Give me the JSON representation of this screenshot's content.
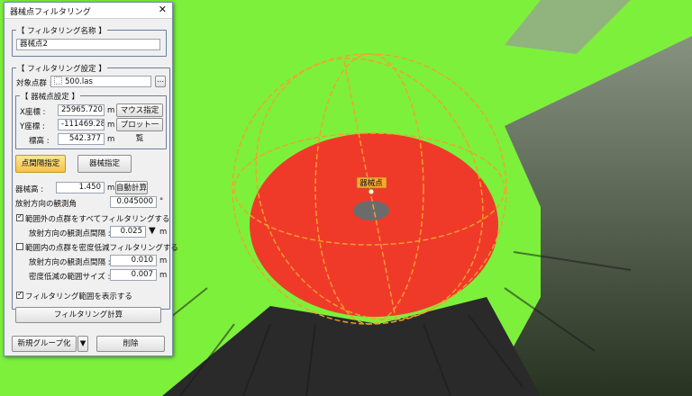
{
  "panel": {
    "title": "器械点フィルタリング",
    "close_glyph": "✕",
    "name_group": {
      "label": "【 フィルタリング名称 】",
      "value": "器械点2"
    },
    "settings_group": {
      "label": "【 フィルタリング設定 】",
      "target_label": "対象点群 :",
      "target_value": "500.las",
      "browse_glyph": "...",
      "instrument_group": {
        "label": "【 器械点設定 】",
        "x_label": "X座標 :",
        "x_value": "25965.720",
        "y_label": "Y座標 :",
        "y_value": "-111469.285",
        "h_label": "標高 :",
        "h_value": "542.377",
        "unit": "m",
        "mouse_button": "マウス指定",
        "plot_list_button": "プロット一覧"
      },
      "mode_point_spacing": "点間隔指定",
      "mode_grid": "器械指定",
      "instrument_height_label": "器械高 :",
      "instrument_height_value": "1.450",
      "auto_calc_button": "自動計算",
      "radial_angle_label": "放射方向の観測角",
      "radial_angle_value": "0.045000",
      "degree_symbol": "°",
      "outside_checkbox_label": "範囲外の点群をすべてフィルタリングする",
      "outside_checked": true,
      "radial_spacing_label": "放射方向の観測点間隔 :",
      "radial_spacing_value": "0.025",
      "inside_checkbox_label": "範囲内の点群を密度低減フィルタリングする",
      "inside_checked": false,
      "radial_spacing2_label": "放射方向の観測点間隔 :",
      "radial_spacing2_value": "0.010",
      "density_size_label": "密度低減の範囲サイズ :",
      "density_size_value": "0.007",
      "show_range_label": "フィルタリング範囲を表示する",
      "show_range_checked": true,
      "calc_button": "フィルタリング計算"
    },
    "new_group_button": "新規グループ化",
    "dropdown_glyph": "▼",
    "delete_button": "削除"
  },
  "viewport": {
    "marker_label": "器械点",
    "colors": {
      "background_green": "#7df03c",
      "sphere_red": "#ef3a2a",
      "wire_orange": "#f6a02a",
      "label_bg": "#f7a733"
    }
  }
}
